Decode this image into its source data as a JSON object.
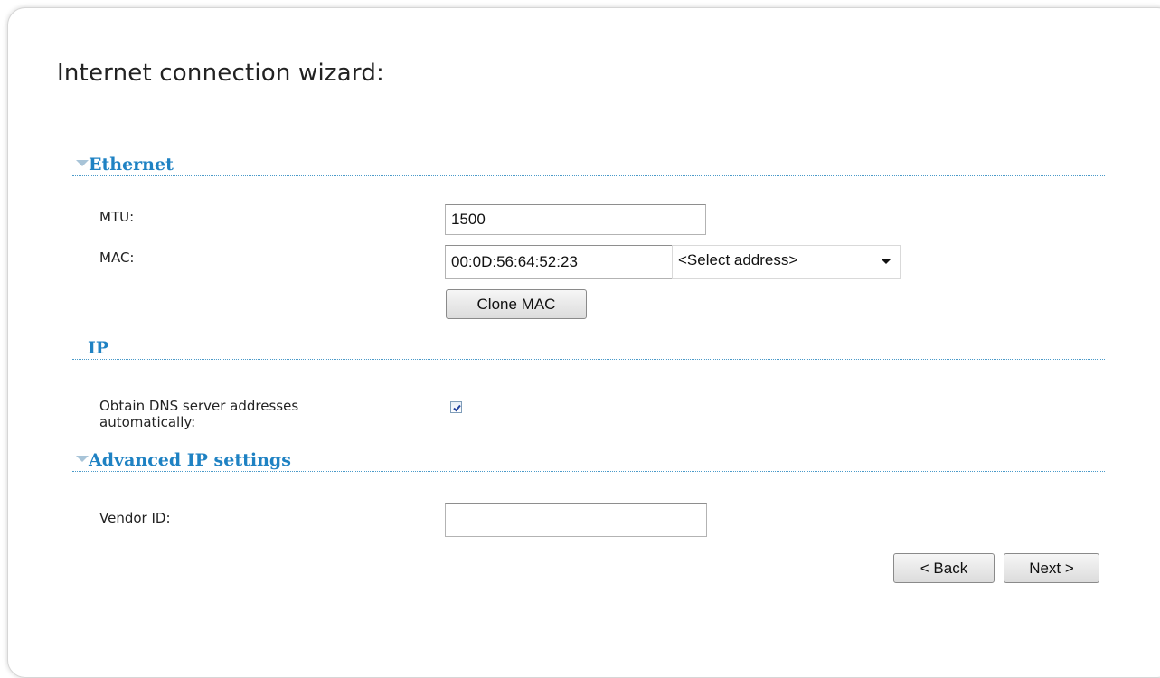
{
  "wizard": {
    "title": "Internet connection wizard:"
  },
  "ethernet": {
    "heading": "Ethernet",
    "mtu": {
      "label": "MTU:",
      "value": "1500"
    },
    "mac": {
      "label": "MAC:",
      "value": "00:0D:56:64:52:23",
      "select_value": "<Select address>",
      "clone_button": "Clone MAC"
    }
  },
  "ip": {
    "heading": "IP",
    "dns_auto": {
      "label": "Obtain DNS server addresses automatically:",
      "checked": true
    }
  },
  "advanced": {
    "heading": "Advanced IP settings",
    "vendor_id": {
      "label": "Vendor ID:",
      "value": ""
    }
  },
  "nav": {
    "back": "< Back",
    "next": "Next >"
  },
  "colors": {
    "section_heading": "#1f82c3",
    "divider": "#4a9ac9"
  }
}
